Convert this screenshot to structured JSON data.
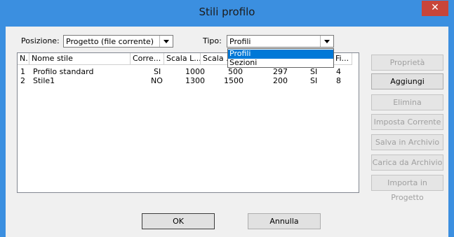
{
  "window": {
    "title": "Stili profilo",
    "close_glyph": "✕"
  },
  "posizione": {
    "label": "Posizione:",
    "value": "Progetto (file corrente)"
  },
  "tipo": {
    "label": "Tipo:",
    "value": "Profili",
    "options": [
      "Profili",
      "Sezioni"
    ]
  },
  "table": {
    "columns": [
      "N.",
      "Nome stile",
      "Corre...",
      "Scala L...",
      "Scala ...",
      "",
      "",
      "Fi..."
    ],
    "rows": [
      [
        "1",
        "Profilo standard",
        "SI",
        "1000",
        "500",
        "297",
        "SI",
        "4"
      ],
      [
        "2",
        "Stile1",
        "NO",
        "1300",
        "1500",
        "200",
        "SI",
        "8"
      ]
    ]
  },
  "side_buttons": {
    "proprieta": "Proprietà",
    "aggiungi": "Aggiungi",
    "elimina": "Elimina",
    "imposta": "Imposta Corrente",
    "salva": "Salva in Archivio",
    "carica": "Carica da Archivio",
    "importa": "Importa in Progetto"
  },
  "bottom_buttons": {
    "ok": "OK",
    "annulla": "Annulla"
  },
  "colors": {
    "titlebar": "#3b8fe0",
    "close": "#c8453a",
    "selection": "#0078d7"
  }
}
